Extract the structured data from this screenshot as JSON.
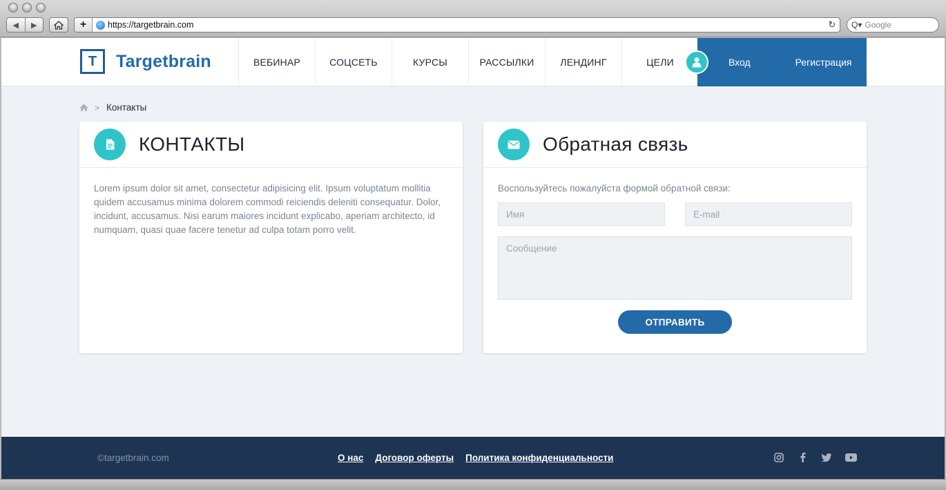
{
  "browser": {
    "url": "https://targetbrain.com",
    "search_placeholder": "Google",
    "back_glyph": "◀",
    "forward_glyph": "▶",
    "new_tab_glyph": "+",
    "reload_glyph": "↻",
    "search_glyph": "Q▾"
  },
  "header": {
    "logo_letter": "T",
    "logo_text": "Targetbrain",
    "menu": [
      {
        "label": "ВЕБИНАР"
      },
      {
        "label": "СОЦСЕТЬ"
      },
      {
        "label": "КУРСЫ"
      },
      {
        "label": "РАССЫЛКИ"
      },
      {
        "label": "ЛЕНДИНГ"
      },
      {
        "label": "ЦЕЛИ"
      }
    ],
    "login_label": "Вход",
    "register_label": "Регистрация"
  },
  "breadcrumb": {
    "current": "Контакты",
    "separator": ">"
  },
  "contacts": {
    "title": "КОНТАКТЫ",
    "text": "Lorem ipsum dolor sit amet, consectetur adipisicing elit. Ipsum voluptatum mollitia quidem accusamus minima dolorem commodi reiciendis deleniti consequatur. Dolor, incidunt, accusamus. Nisi earum maiores incidunt explicabo, aperiam architecto, id numquam, quasi quae facere tenetur ad culpa totam porro velit."
  },
  "feedback": {
    "title": "Обратная связь",
    "intro": "Воспользуйтесь пожалуйста формой обратной связи:",
    "name_placeholder": "Имя",
    "email_placeholder": "E-mail",
    "message_placeholder": "Сообщение",
    "send_label": "ОТПРАВИТЬ"
  },
  "footer": {
    "copyright": "©targetbrain.com",
    "links": [
      {
        "label": "О нас"
      },
      {
        "label": "Договор оферты"
      },
      {
        "label": "Политика конфиденциальности"
      }
    ],
    "social_icons": [
      "instagram-icon",
      "facebook-icon",
      "twitter-icon",
      "youtube-icon"
    ]
  },
  "colors": {
    "brand_blue": "#236aa8",
    "accent_teal": "#2fc4c8",
    "footer_bg": "#1e3453",
    "page_bg": "#eef2f6"
  }
}
